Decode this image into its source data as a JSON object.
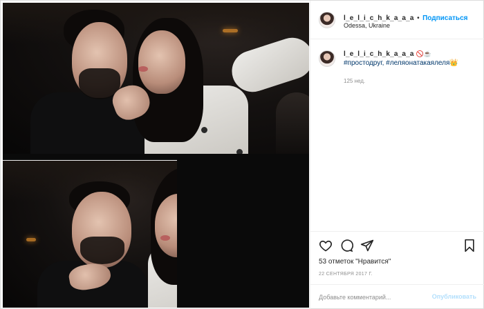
{
  "post": {
    "username": "l_e_l_i_c_h_k_a_a_a",
    "follow_separator": "•",
    "follow_label": "Подписаться",
    "location": "Odessa, Ukraine",
    "caption_user": "l_e_l_i_c_h_k_a_a_a",
    "caption_emoji": "🚫☕",
    "caption_tags": "#простодруг, #леляонатакаялеля👑",
    "time_ago": "125 нед.",
    "likes": "53 отметок \"Нравится\"",
    "date": "22 СЕНТЯБРЯ 2017 Г.",
    "comment_placeholder": "Добавьте комментарий...",
    "publish_label": "Опубликовать"
  },
  "icons": {
    "like": "heart-icon",
    "comment": "comment-icon",
    "share": "share-icon",
    "save": "bookmark-icon"
  },
  "colors": {
    "link": "#0095f6",
    "publish_disabled": "#b2dffc",
    "hashtag": "#00376b",
    "muted": "#8e8e8e"
  }
}
